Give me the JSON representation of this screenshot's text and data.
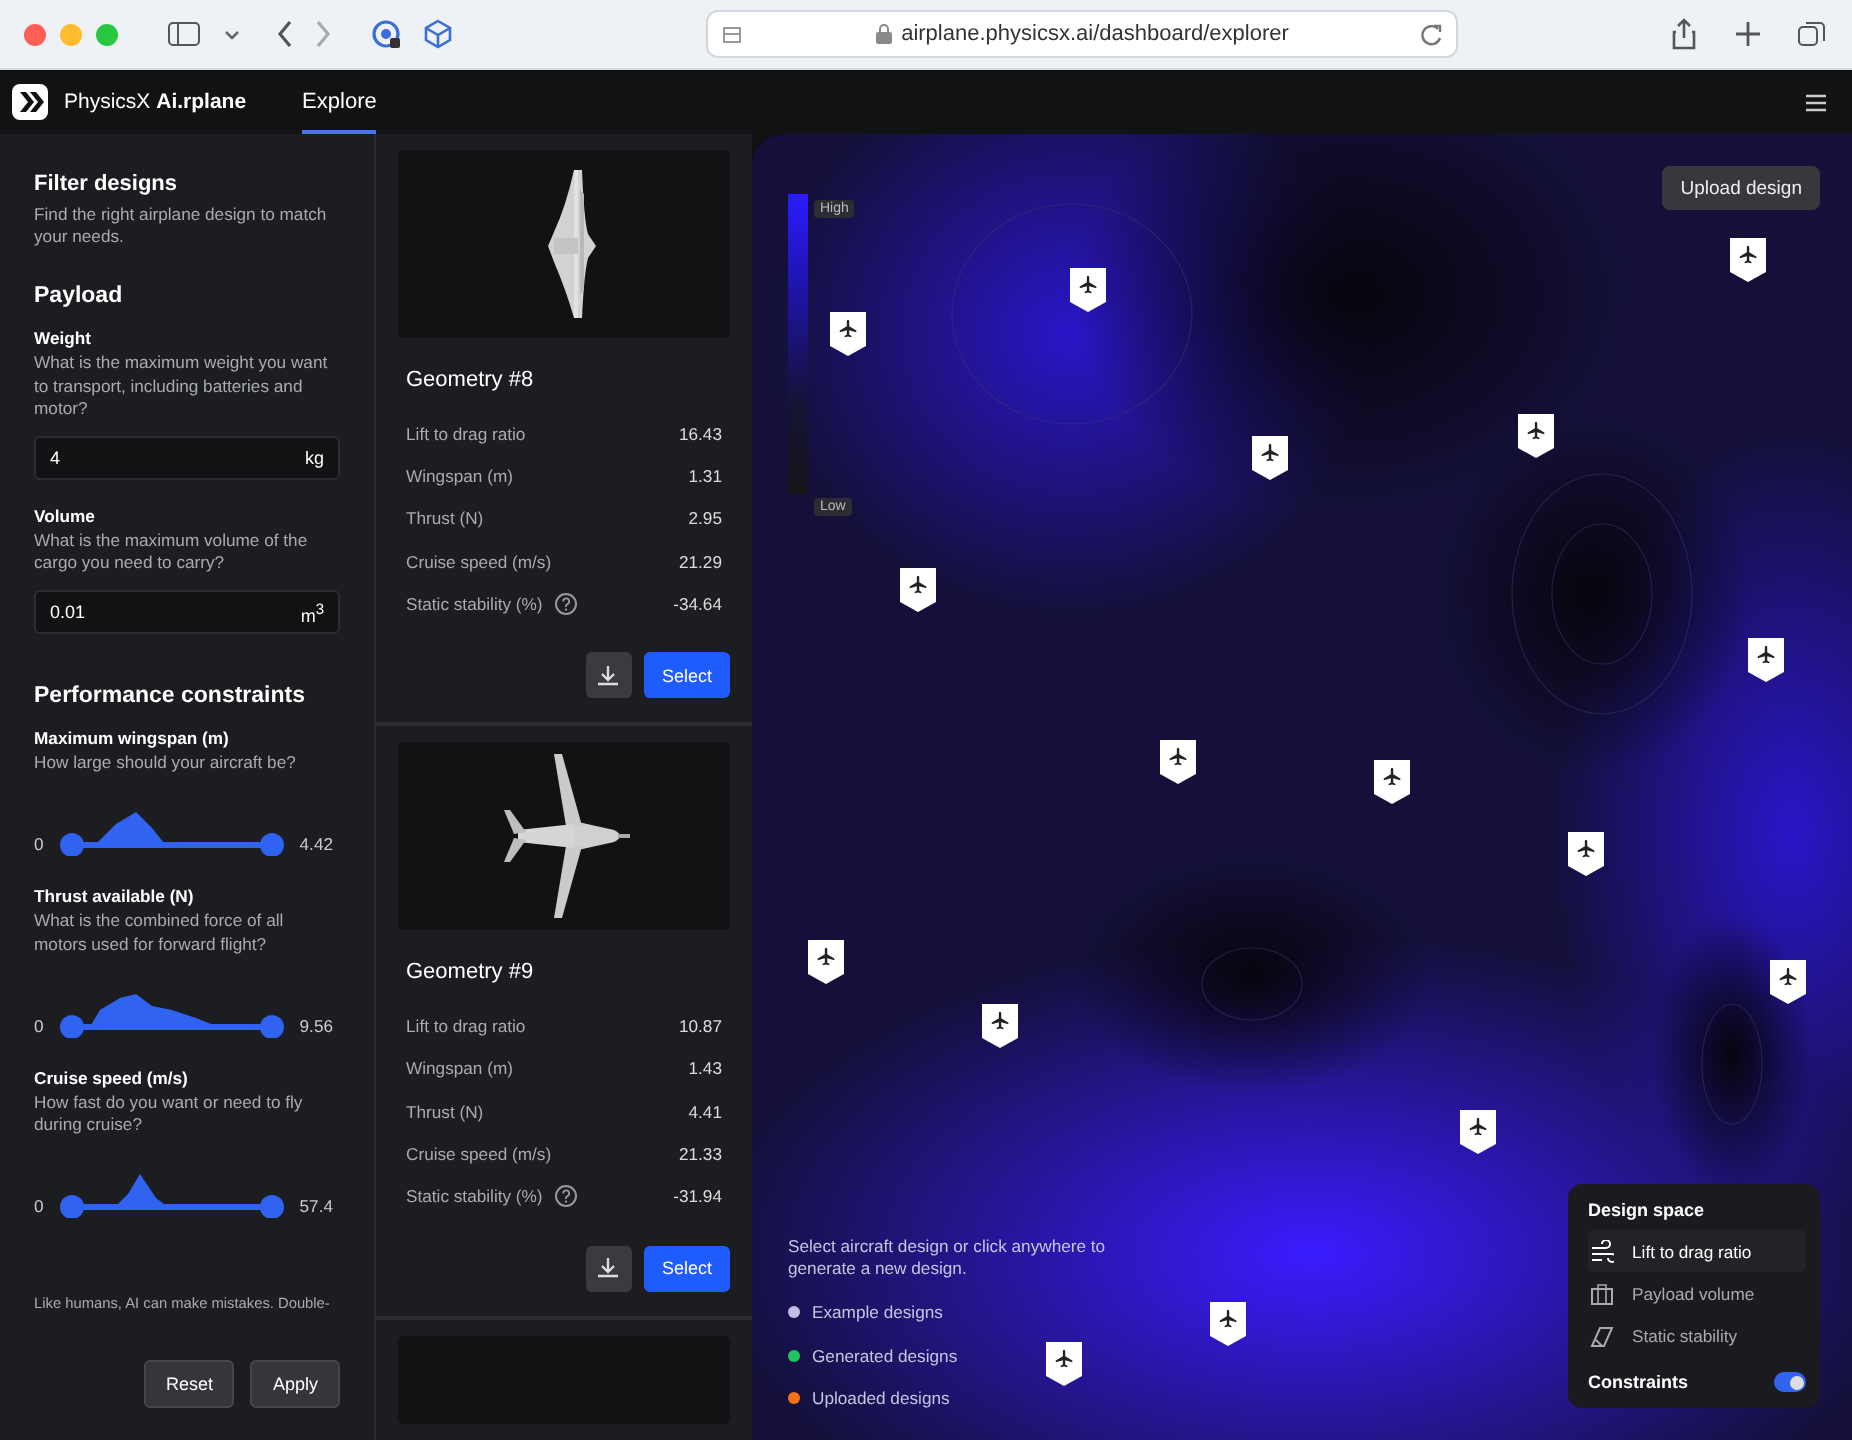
{
  "browser": {
    "url": "airplane.physicsx.ai/dashboard/explorer"
  },
  "app": {
    "brand": "PhysicsX **Ai.rplane**",
    "nav": [
      {
        "label": "Explore",
        "selected": true
      }
    ]
  },
  "filter": {
    "title": "Filter designs",
    "subtitle": "Find the right airplane design to match your needs.",
    "payload": {
      "title": "Payload",
      "fields": [
        {
          "label": "Weight",
          "help": "What is the maximum weight you want to transport, including batteries and motor?",
          "value": "4",
          "unit": "kg"
        },
        {
          "label": "Volume",
          "help": "What is the maximum volume of the cargo you need to carry?",
          "value": "0.01",
          "unit": "m$^{3}$"
        }
      ]
    },
    "performance": {
      "title": "Performance constraints",
      "sliders": [
        {
          "label": "Maximum wingspan (m)",
          "help": "How large should your aircraft be?",
          "min": "0",
          "max": "4.42",
          "level": 1
        },
        {
          "label": "Thrust available (N)",
          "help": "What is the combined force of all motors used for forward flight?",
          "min": "0",
          "max": "9.56",
          "level": 1
        },
        {
          "label": "Cruise speed (m/s)",
          "help": "How fast do you want or need to fly during cruise?",
          "min": "0",
          "max": "57.4",
          "level": 1
        }
      ]
    },
    "disclaimer": "Like humans, AI can make mistakes. Double-",
    "buttons": [
      "Reset",
      "Apply"
    ]
  },
  "designs": [
    {
      "title": "Geometry #8",
      "properties": [
        {
          "name": "Lift to drag ratio",
          "value": "16.43"
        },
        {
          "name": "Wingspan (m)",
          "value": "1.31"
        },
        {
          "name": "Thrust (N)",
          "value": "2.95"
        },
        {
          "name": "Cruise speed (m/s)",
          "value": "21.29"
        },
        {
          "name": "Static stability (%)",
          "value": "-34.64",
          "help": true
        }
      ],
      "button": "Select"
    },
    {
      "title": "Geometry #9",
      "properties": [
        {
          "name": "Lift to drag ratio",
          "value": "10.87"
        },
        {
          "name": "Wingspan (m)",
          "value": "1.43"
        },
        {
          "name": "Thrust (N)",
          "value": "4.41"
        },
        {
          "name": "Cruise speed (m/s)",
          "value": "21.33"
        },
        {
          "name": "Static stability (%)",
          "value": "-31.94",
          "help": true
        }
      ],
      "button": "Select"
    }
  ],
  "map": {
    "upload_button": "Upload design",
    "scale": {
      "high": "High",
      "low": "Low"
    },
    "hint": "Select aircraft design or click anywhere to generate a new design.",
    "legend": [
      {
        "label": "Example designs",
        "color": "#c4bde6"
      },
      {
        "label": "Generated designs",
        "color": "#22c55e"
      },
      {
        "label": "Uploaded designs",
        "color": "#f97316"
      }
    ],
    "design_space": {
      "title": "Design space",
      "items": [
        {
          "label": "Lift to drag ratio",
          "kind": "aero",
          "selected": true
        },
        {
          "label": "Payload volume",
          "kind": "payload",
          "selected": false
        },
        {
          "label": "Static stability",
          "kind": "stability",
          "selected": false
        }
      ],
      "constraints": {
        "label": "Constraints",
        "on": true
      }
    }
  }
}
